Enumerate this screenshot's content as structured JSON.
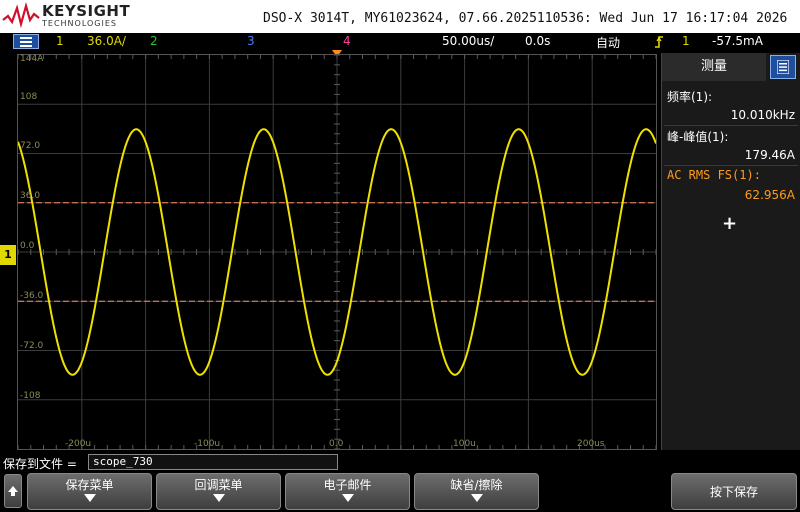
{
  "header": {
    "brand": "KEYSIGHT",
    "brand_sub": "TECHNOLOGIES",
    "device_info": "DSO-X 3014T, MY61023624, 07.66.2025110536: Wed Jun 17 16:17:04 2026"
  },
  "status": {
    "ch1_num": "1",
    "ch1_scale": "36.0A/",
    "ch2": "2",
    "ch3": "3",
    "ch4": "4",
    "timebase": "50.00us/",
    "delay": "0.0s",
    "trigger_mode": "自动",
    "trigger_source": "1",
    "trigger_level": "-57.5mA",
    "colors": {
      "ch1": "#e0d800",
      "ch2": "#30c030",
      "ch3": "#4a7dff",
      "ch4": "#ff40a0",
      "trigger": "#ff8c1a"
    }
  },
  "graticule": {
    "y_labels": [
      "144A",
      "108",
      "72.0",
      "36.0",
      "0.0",
      "-36.0",
      "-72.0",
      "-108"
    ],
    "x_labels": [
      "-200u",
      "-100u",
      "0.0",
      "100u",
      "200us"
    ],
    "ch1_marker": "1"
  },
  "measurements": {
    "title": "测量",
    "items": [
      {
        "label": "频率(1):",
        "value": "10.010kHz",
        "highlight": false
      },
      {
        "label": "峰-峰值(1):",
        "value": "179.46A",
        "highlight": false
      },
      {
        "label": "AC RMS FS(1):",
        "value": "62.956A",
        "highlight": true
      }
    ],
    "add_symbol": "+",
    "highlight_color": "#ff9c1a"
  },
  "save": {
    "label": "保存到文件 =",
    "filename": "scope_730"
  },
  "softkeys": {
    "key1": "保存菜单",
    "key2": "回调菜单",
    "key3": "电子邮件",
    "key4": "缺省/擦除",
    "save_button": "按下保存"
  },
  "chart_data": {
    "type": "line",
    "title": "",
    "xlabel": "",
    "ylabel": "",
    "xlim": [
      -250,
      250
    ],
    "ylim": [
      -144,
      144
    ],
    "frequency_khz": 10.01,
    "peak_to_peak": 179.46,
    "offset": 0,
    "cursor_levels": [
      36.0,
      -36.0
    ],
    "series": [
      {
        "name": "1",
        "color": "#f0e000"
      }
    ]
  }
}
